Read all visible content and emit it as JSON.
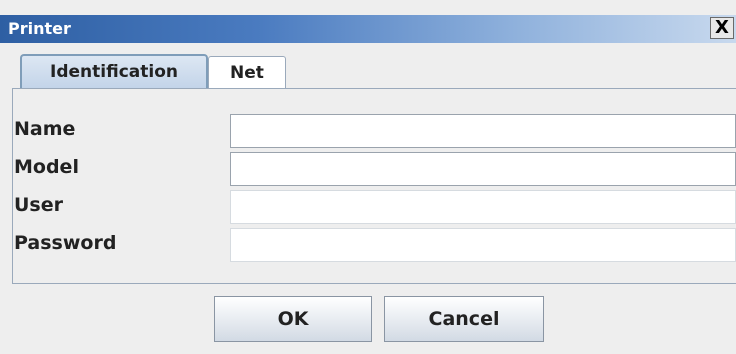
{
  "window": {
    "title": "Printer",
    "close_glyph": "X"
  },
  "tabs": [
    {
      "label": "Identification",
      "selected": true
    },
    {
      "label": "Net",
      "selected": false
    }
  ],
  "form": {
    "fields": [
      {
        "label": "Name",
        "value": ""
      },
      {
        "label": "Model",
        "value": ""
      },
      {
        "label": "User",
        "value": ""
      },
      {
        "label": "Password",
        "value": ""
      }
    ]
  },
  "buttons": {
    "ok": "OK",
    "cancel": "Cancel"
  }
}
